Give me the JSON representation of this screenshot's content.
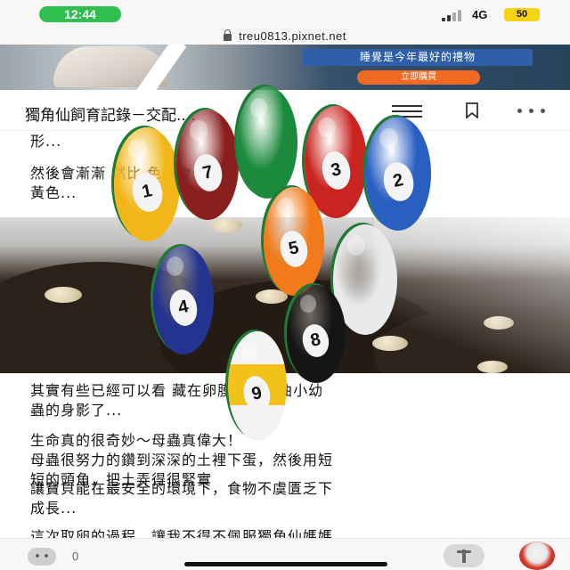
{
  "status_bar": {
    "time": "12:44",
    "network": "4G",
    "battery": "50"
  },
  "browser": {
    "url": "treu0813.pixnet.net"
  },
  "ad_banner": {
    "headline": "睡覺是今年最好的禮物",
    "button": "立即購買"
  },
  "header": {
    "title": "獨角仙飼育記錄－交配...."
  },
  "article": {
    "p1": "形...",
    "p2_line1": "然後會漸漸            然比       色也會偏",
    "p2_line2": "黃色...",
    "p3_line1": "其實有些已經可以看      藏在卵膜下的蜷曲小幼",
    "p3_line2": "蟲的身影了...",
    "p4_line1": "生命真的很奇妙～母蟲真偉大！",
    "p4_line2": "母蟲很努力的鑽到深深的土裡下蛋，然後用短",
    "p4_line3": "短的頭角，把土弄得很緊實",
    "p4_line4": "讓寶貝能在最安全的環境下，食物不虞匱乏下",
    "p4_line5": "成長...",
    "p5_line1": "這次取卵的過程，讓我不得不佩服獨角仙媽媽"
  },
  "bottom_bar": {
    "count": "0"
  },
  "colors": {
    "status_pill": "#2fbf4f",
    "battery": "#f5d315",
    "ad_button": "#f06a23",
    "ad_headline_bg": "#2e5fa8"
  },
  "icons": [
    "lock-icon",
    "menu-icon",
    "bookmark-icon",
    "more-icon",
    "face-icon",
    "share-icon",
    "avatar"
  ],
  "overlay_balls": [
    {
      "number": "1",
      "color": "#f2b619"
    },
    {
      "number": "7",
      "color": "#8a1f1f"
    },
    {
      "number": "",
      "color": "#1c8a3c"
    },
    {
      "number": "3",
      "color": "#c9241f"
    },
    {
      "number": "2",
      "color": "#2a5fc2"
    },
    {
      "number": "5",
      "color": "#f27a1a"
    },
    {
      "number": "",
      "color": "#eaeaea"
    },
    {
      "number": "4",
      "color": "#23338f"
    },
    {
      "number": "8",
      "color": "#151515"
    },
    {
      "number": "9",
      "color": "#f2c21a"
    }
  ]
}
